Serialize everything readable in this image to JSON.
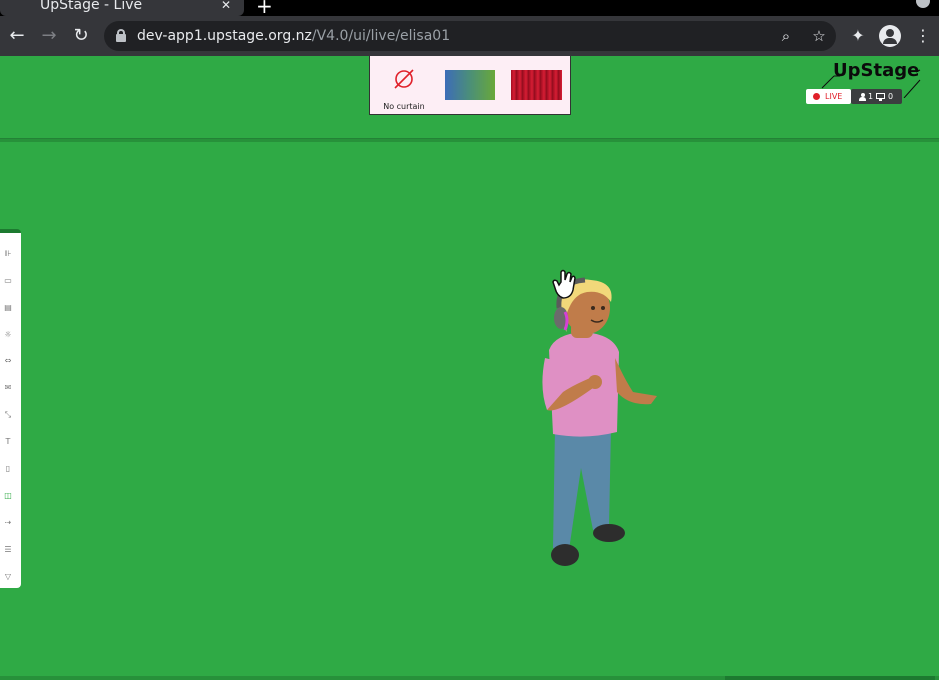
{
  "browser": {
    "tab_title": "UpStage - Live",
    "tab_close": "✕",
    "new_tab": "+",
    "url_host": "dev-app1.upstage.org.nz",
    "url_path": "/V4.0/ui/live/elisa01",
    "icons": [
      "back-icon",
      "forward-icon",
      "reload-icon",
      "lock-icon",
      "zoom-icon",
      "star-icon",
      "extensions-icon",
      "profile-icon",
      "menu-icon"
    ]
  },
  "curtains": {
    "none_label": "No curtain",
    "items": [
      "no-curtain",
      "gradient-curtain",
      "red-curtain"
    ]
  },
  "header": {
    "logo": "UpStage",
    "live_label": "LIVE",
    "players_count": "1",
    "audience_count": "0"
  },
  "colors": {
    "stage_background": "#2faa45",
    "live_red": "#e0202a",
    "curtain_panel": "#fdeef5"
  },
  "toolbox": {
    "items": [
      "⊪",
      "▭",
      "▤",
      "☼",
      "⇔",
      "✉",
      "⤡",
      "T",
      "▯",
      "◫",
      "⇢",
      "☰",
      "▽"
    ]
  }
}
